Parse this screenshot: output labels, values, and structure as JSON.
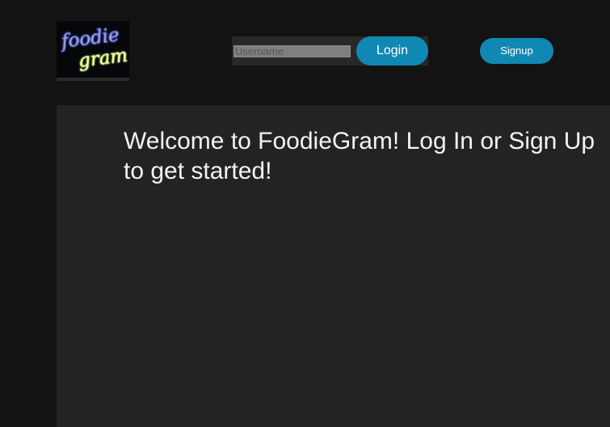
{
  "header": {
    "logo": {
      "line1": "foodie",
      "line2": "gram"
    },
    "login": {
      "username_placeholder": "Username",
      "login_label": "Login"
    },
    "signup_label": "Signup"
  },
  "main": {
    "welcome": "Welcome to FoodieGram! Log In or Sign Up to get started!"
  },
  "colors": {
    "page_background": "#131313",
    "panel_background": "#232323",
    "button_blue": "#0f89b3",
    "text": "#f3f3f3"
  }
}
